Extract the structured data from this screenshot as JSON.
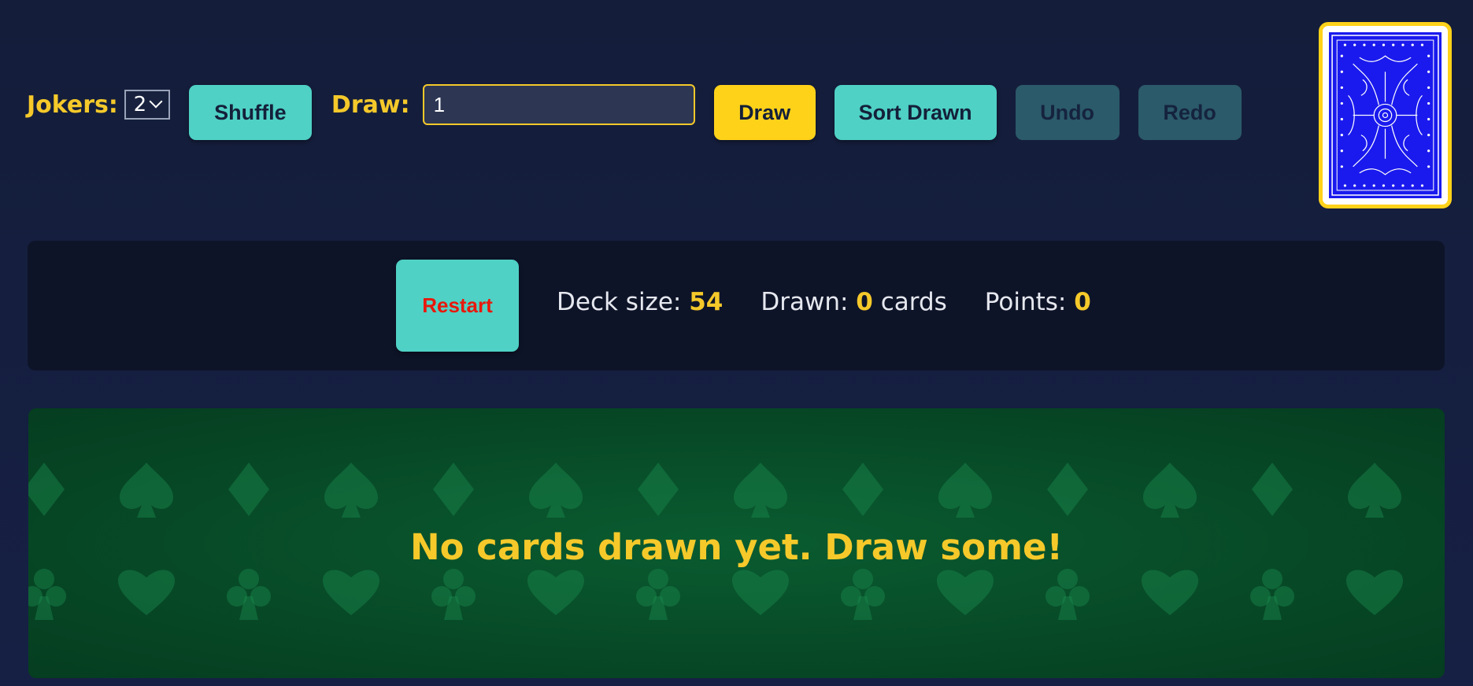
{
  "toolbar": {
    "jokers_label": "Jokers:",
    "jokers_value": "2",
    "shuffle_label": "Shuffle",
    "draw_label": "Draw:",
    "draw_input_value": "1",
    "draw_button_label": "Draw",
    "sort_label": "Sort Drawn",
    "undo_label": "Undo",
    "redo_label": "Redo"
  },
  "status": {
    "restart_label": "Restart",
    "deck_size_label": "Deck size:",
    "deck_size_value": "54",
    "drawn_label": "Drawn:",
    "drawn_value": "0",
    "drawn_suffix": "cards",
    "points_label": "Points:",
    "points_value": "0"
  },
  "table": {
    "empty_message": "No cards drawn yet. Draw some!"
  },
  "icons": {
    "card_back": "card-back-icon",
    "suit_pattern": "suit-pattern-icon"
  },
  "colors": {
    "background": "#141d3a",
    "accent_yellow": "#ffd21a",
    "accent_teal": "#4fd1c5",
    "restart_text": "#e8180c",
    "felt_green": "#074a27",
    "card_blue": "#1a1aee"
  }
}
